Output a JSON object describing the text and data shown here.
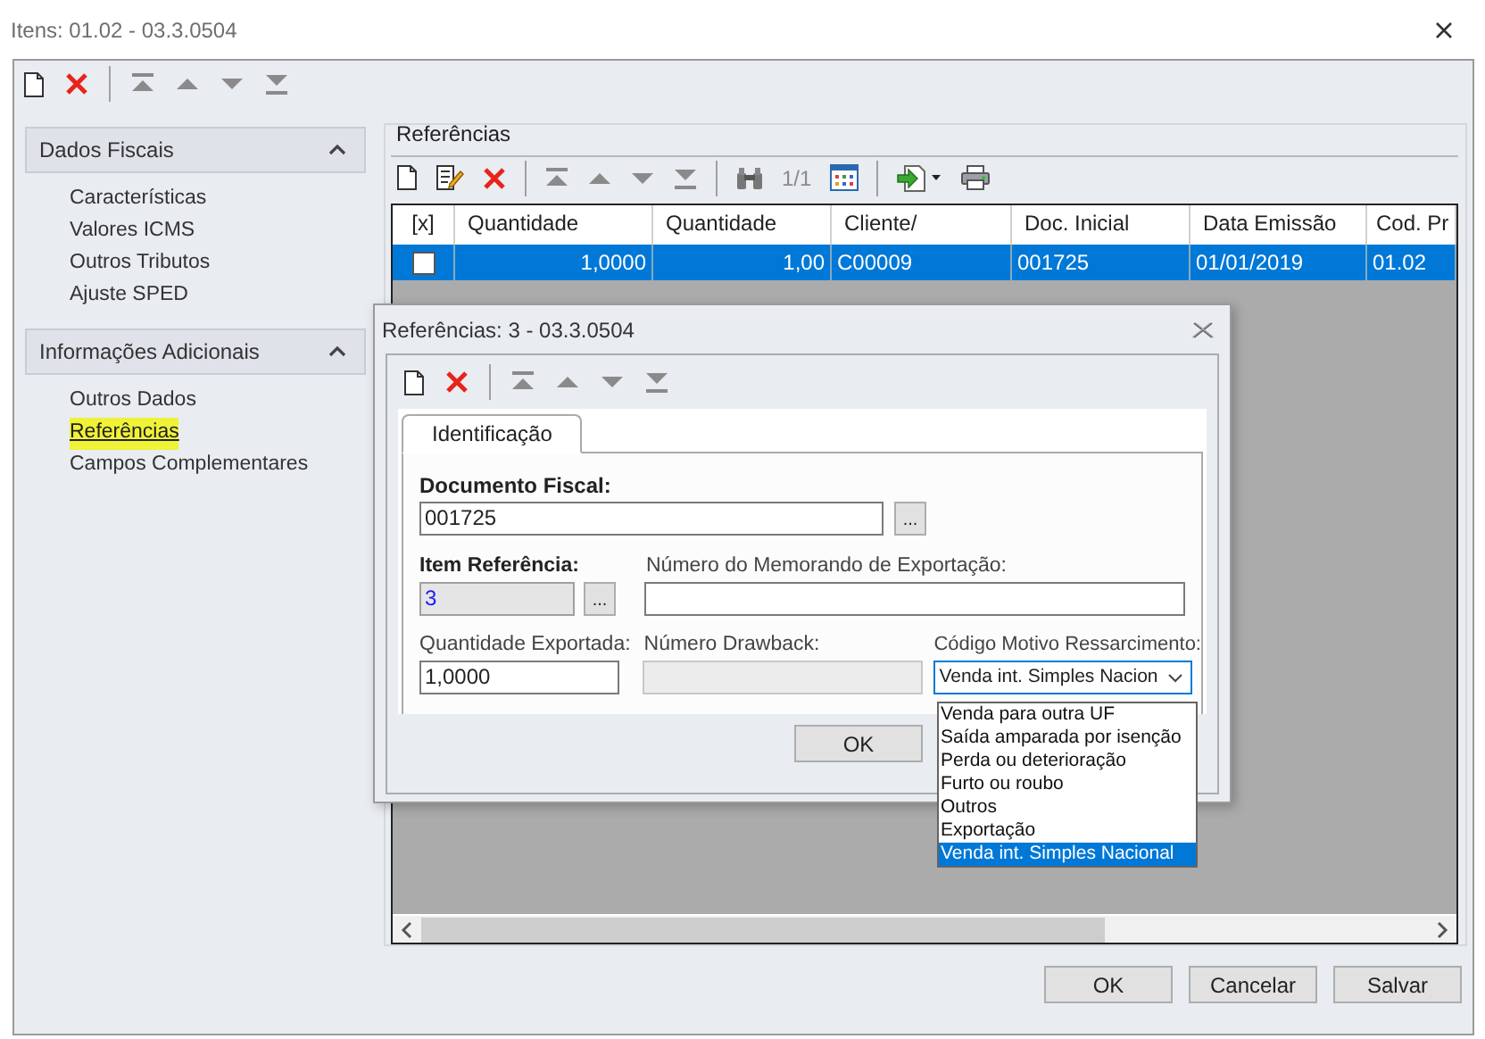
{
  "window": {
    "title": "Itens: 01.02 - 03.3.0504"
  },
  "sidebar": {
    "sections": [
      {
        "title": "Dados Fiscais",
        "expanded": true,
        "items": [
          {
            "label": "Características",
            "selected": false
          },
          {
            "label": "Valores ICMS",
            "selected": false
          },
          {
            "label": "Outros Tributos",
            "selected": false
          },
          {
            "label": "Ajuste SPED",
            "selected": false
          }
        ]
      },
      {
        "title": "Informações Adicionais",
        "expanded": true,
        "items": [
          {
            "label": "Outros Dados",
            "selected": false
          },
          {
            "label": "Referências",
            "selected": true
          },
          {
            "label": "Campos Complementares",
            "selected": false
          }
        ]
      }
    ]
  },
  "references": {
    "title": "Referências",
    "page": "1/1",
    "table": {
      "columns": [
        "[x]",
        "Quantidade",
        "Quantidade",
        "Cliente/",
        "Doc. Inicial",
        "Data Emissão",
        "Cod. Pr"
      ],
      "rows": [
        {
          "selected": true,
          "checked": false,
          "cells": [
            "",
            "1,0000",
            "1,00",
            "C00009",
            "001725",
            "01/01/2019",
            "01.02"
          ]
        }
      ]
    }
  },
  "buttons": [
    "OK",
    "Cancelar",
    "Salvar"
  ],
  "dialog": {
    "title": "Referências: 3 - 03.3.0504",
    "tabs": [
      {
        "label": "Identificação",
        "selected": true
      }
    ],
    "documento_fiscal": {
      "label": "Documento Fiscal:",
      "required": true,
      "value": "001725",
      "browse": "..."
    },
    "item_referencia": {
      "label": "Item Referência:",
      "required": true,
      "readonly": true,
      "value": "3",
      "browse": "..."
    },
    "memorando": {
      "label": "Número do Memorando de Exportação:"
    },
    "quantidade_exportada": {
      "label": "Quantidade Exportada:",
      "value": "1,0000"
    },
    "drawback": {
      "label": "Número Drawback:",
      "disabled": true
    },
    "motivo": {
      "label": "Código Motivo Ressarcimento:",
      "value": "Venda int. Simples Nacion",
      "expanded": true,
      "options": [
        {
          "label": "Venda para outra UF",
          "selected": false
        },
        {
          "label": "Saída amparada por isenção",
          "selected": false
        },
        {
          "label": "Perda ou deterioração",
          "selected": false
        },
        {
          "label": "Furto ou roubo",
          "selected": false
        },
        {
          "label": "Outros",
          "selected": false
        },
        {
          "label": "Exportação",
          "selected": false
        },
        {
          "label": "Venda int. Simples Nacional",
          "selected": true
        }
      ]
    },
    "buttons": [
      "OK"
    ]
  }
}
